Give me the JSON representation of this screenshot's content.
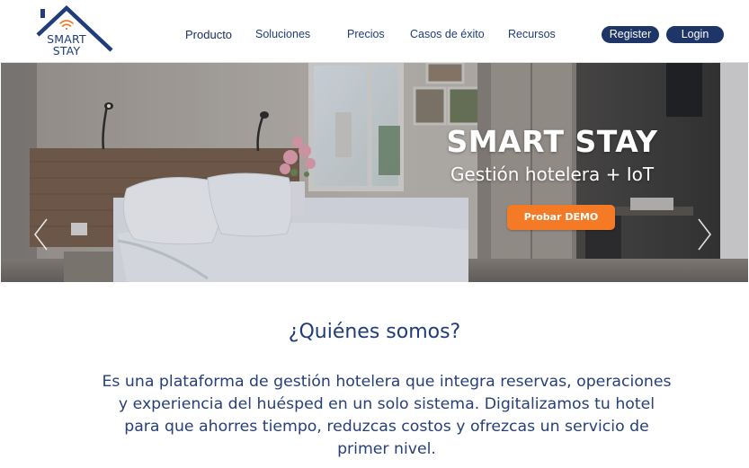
{
  "brand": {
    "line1": "SMART",
    "line2": "STAY",
    "primary_color": "#1f3d7a",
    "accent_color": "#f47a25"
  },
  "nav": {
    "items": [
      {
        "label": "Producto"
      },
      {
        "label": "Soluciones"
      },
      {
        "label": "Precios"
      },
      {
        "label": "Casos de éxito"
      },
      {
        "label": "Recursos"
      }
    ],
    "register_label": "Register",
    "login_label": "Login"
  },
  "hero": {
    "title": "SMART STAY",
    "subtitle": "Gestión hotelera + IoT",
    "cta_label": "Probar DEMO",
    "prev_icon": "chevron-left-icon",
    "next_icon": "chevron-right-icon"
  },
  "about": {
    "title": "¿Quiénes somos?",
    "body": "Es una plataforma de gestión hotelera que integra reservas, operaciones y experiencia del huésped en un solo sistema. Digitalizamos tu hotel para que ahorres tiempo, reduzcas costos y ofrezcas un servicio de primer nivel."
  }
}
